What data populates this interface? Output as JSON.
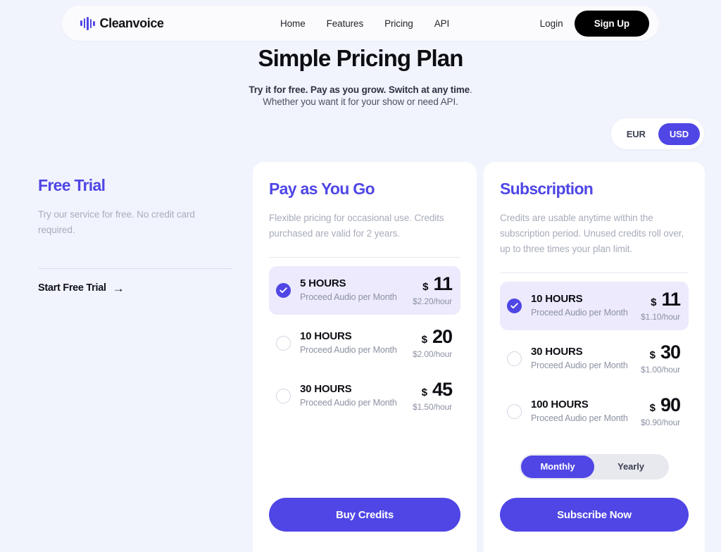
{
  "brand": {
    "name": "Cleanvoice",
    "logo_icon": "audio-waveform-icon"
  },
  "nav": {
    "links": [
      {
        "label": "Home"
      },
      {
        "label": "Features"
      },
      {
        "label": "Pricing"
      },
      {
        "label": "API"
      }
    ],
    "login_label": "Login",
    "signup_label": "Sign Up"
  },
  "hero": {
    "title": "Simple Pricing Plan",
    "subline_bold": "Try it for free. Pay as you grow. Switch at any time",
    "subline_bold_tail": ".",
    "subline_normal": "Whether you want it for your show or need API."
  },
  "currency": {
    "options": [
      {
        "label": "EUR",
        "active": false
      },
      {
        "label": "USD",
        "active": true
      }
    ]
  },
  "free_trial": {
    "title": "Free Trial",
    "description": "Try our service for free. No credit card required.",
    "cta_label": "Start Free Trial",
    "cta_arrow": "→"
  },
  "payg": {
    "title": "Pay as You Go",
    "description": "Flexible pricing for occasional use. Credits purchased are valid for 2 years.",
    "options": [
      {
        "hours": "5 HOURS",
        "sub": "Proceed Audio per Month",
        "currency_symbol": "$",
        "amount": "11",
        "per_hour": "$2.20/hour",
        "selected": true
      },
      {
        "hours": "10 HOURS",
        "sub": "Proceed Audio per Month",
        "currency_symbol": "$",
        "amount": "20",
        "per_hour": "$2.00/hour",
        "selected": false
      },
      {
        "hours": "30 HOURS",
        "sub": "Proceed Audio per Month",
        "currency_symbol": "$",
        "amount": "45",
        "per_hour": "$1.50/hour",
        "selected": false
      }
    ],
    "cta_label": "Buy Credits"
  },
  "subscription": {
    "title": "Subscription",
    "description": "Credits are usable anytime within the subscription period. Unused credits roll over, up to three times your plan limit.",
    "options": [
      {
        "hours": "10 HOURS",
        "sub": "Proceed Audio per Month",
        "currency_symbol": "$",
        "amount": "11",
        "per_hour": "$1.10/hour",
        "selected": true
      },
      {
        "hours": "30 HOURS",
        "sub": "Proceed Audio per Month",
        "currency_symbol": "$",
        "amount": "30",
        "per_hour": "$1.00/hour",
        "selected": false
      },
      {
        "hours": "100 HOURS",
        "sub": "Proceed Audio per Month",
        "currency_symbol": "$",
        "amount": "90",
        "per_hour": "$0.90/hour",
        "selected": false
      }
    ],
    "billing": {
      "options": [
        {
          "label": "Monthly",
          "active": true
        },
        {
          "label": "Yearly",
          "active": false
        }
      ]
    },
    "cta_label": "Subscribe Now"
  },
  "colors": {
    "accent": "#4f46e5",
    "page_background": "#f2f4fd",
    "card_background": "#ffffff",
    "selected_row_background": "#eceafc",
    "signup_background": "#000000",
    "muted_text": "#a8acbb"
  }
}
